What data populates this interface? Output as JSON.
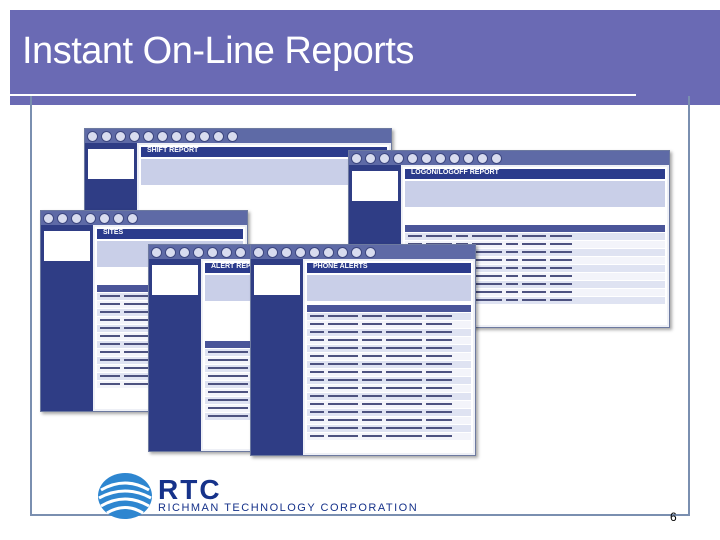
{
  "slide": {
    "title": "Instant On-Line Reports",
    "page_number": "6"
  },
  "footer": {
    "logo_mark": "RTC",
    "company": "RICHMAN TECHNOLOGY CORPORATION"
  },
  "screenshots": {
    "window_1_heading": "SHIFT REPORT",
    "window_2_heading": "LOGON/LOGOFF REPORT",
    "window_3_heading": "SITES",
    "window_4_heading": "ALERT REPORT",
    "window_5_heading": "PHONE ALERTS"
  },
  "colors": {
    "title_band": "#6a6ab4",
    "window_chrome": "#2f3d85",
    "brand_blue": "#16328a"
  }
}
